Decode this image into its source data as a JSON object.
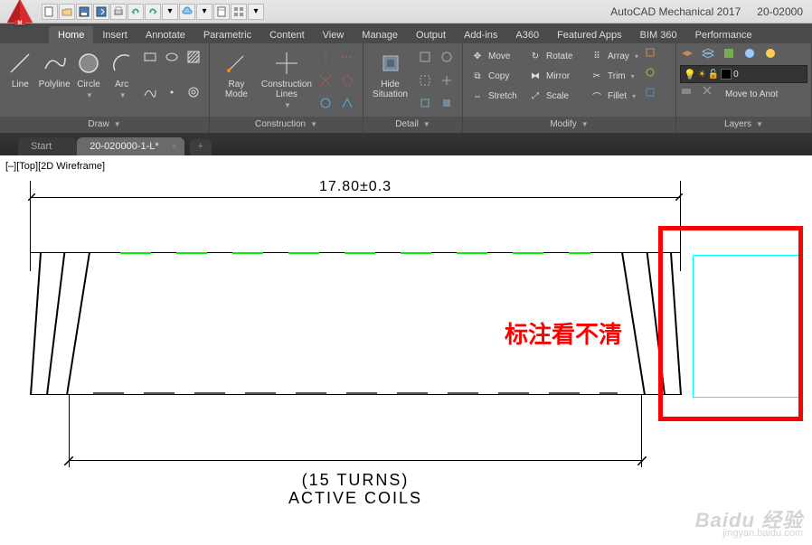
{
  "title": {
    "app": "AutoCAD Mechanical 2017",
    "doc": "20-02000"
  },
  "qat_icons": [
    "new",
    "open",
    "save",
    "saveas",
    "print",
    "undo",
    "redo",
    "dropdown",
    "cloud",
    "dropdown2",
    "sheet",
    "grid",
    "dropdown3"
  ],
  "menu": {
    "tabs": [
      "Home",
      "Insert",
      "Annotate",
      "Parametric",
      "Content",
      "View",
      "Manage",
      "Output",
      "Add-ins",
      "A360",
      "Featured Apps",
      "BIM 360",
      "Performance"
    ],
    "active": 0
  },
  "ribbon": {
    "draw": {
      "title": "Draw",
      "items": [
        {
          "label": "Line"
        },
        {
          "label": "Polyline"
        },
        {
          "label": "Circle"
        },
        {
          "label": "Arc"
        }
      ]
    },
    "construction": {
      "title": "Construction",
      "items": [
        {
          "label": "Ray\nMode"
        },
        {
          "label": "Construction\nLines"
        }
      ]
    },
    "detail": {
      "title": "Detail",
      "items": [
        {
          "label": "Hide\nSituation"
        }
      ]
    },
    "modify": {
      "title": "Modify",
      "rows": [
        [
          {
            "ic": "move",
            "label": "Move"
          },
          {
            "ic": "rotate",
            "label": "Rotate"
          },
          {
            "ic": "array",
            "label": "Array"
          }
        ],
        [
          {
            "ic": "copy",
            "label": "Copy"
          },
          {
            "ic": "mirror",
            "label": "Mirror"
          },
          {
            "ic": "trim",
            "label": "Trim"
          }
        ],
        [
          {
            "ic": "stretch",
            "label": "Stretch"
          },
          {
            "ic": "scale",
            "label": "Scale"
          },
          {
            "ic": "fillet",
            "label": "Fillet"
          }
        ]
      ]
    },
    "layers": {
      "title": "Layers",
      "move_label": "Move to Anot",
      "layer_value": "0"
    }
  },
  "file_tabs": {
    "items": [
      {
        "label": "Start"
      },
      {
        "label": "20-020000-1-L*"
      }
    ],
    "active": 1
  },
  "viewport_state": "[–][Top][2D Wireframe]",
  "dimension_top": "17.80±0.3",
  "dimension_bottom": {
    "line1": "(15 TURNS)",
    "line2": "ACTIVE COILS"
  },
  "annotation": "标注看不清",
  "watermark": {
    "brand": "Baidu 经验",
    "url": "jingyan.baidu.com"
  }
}
